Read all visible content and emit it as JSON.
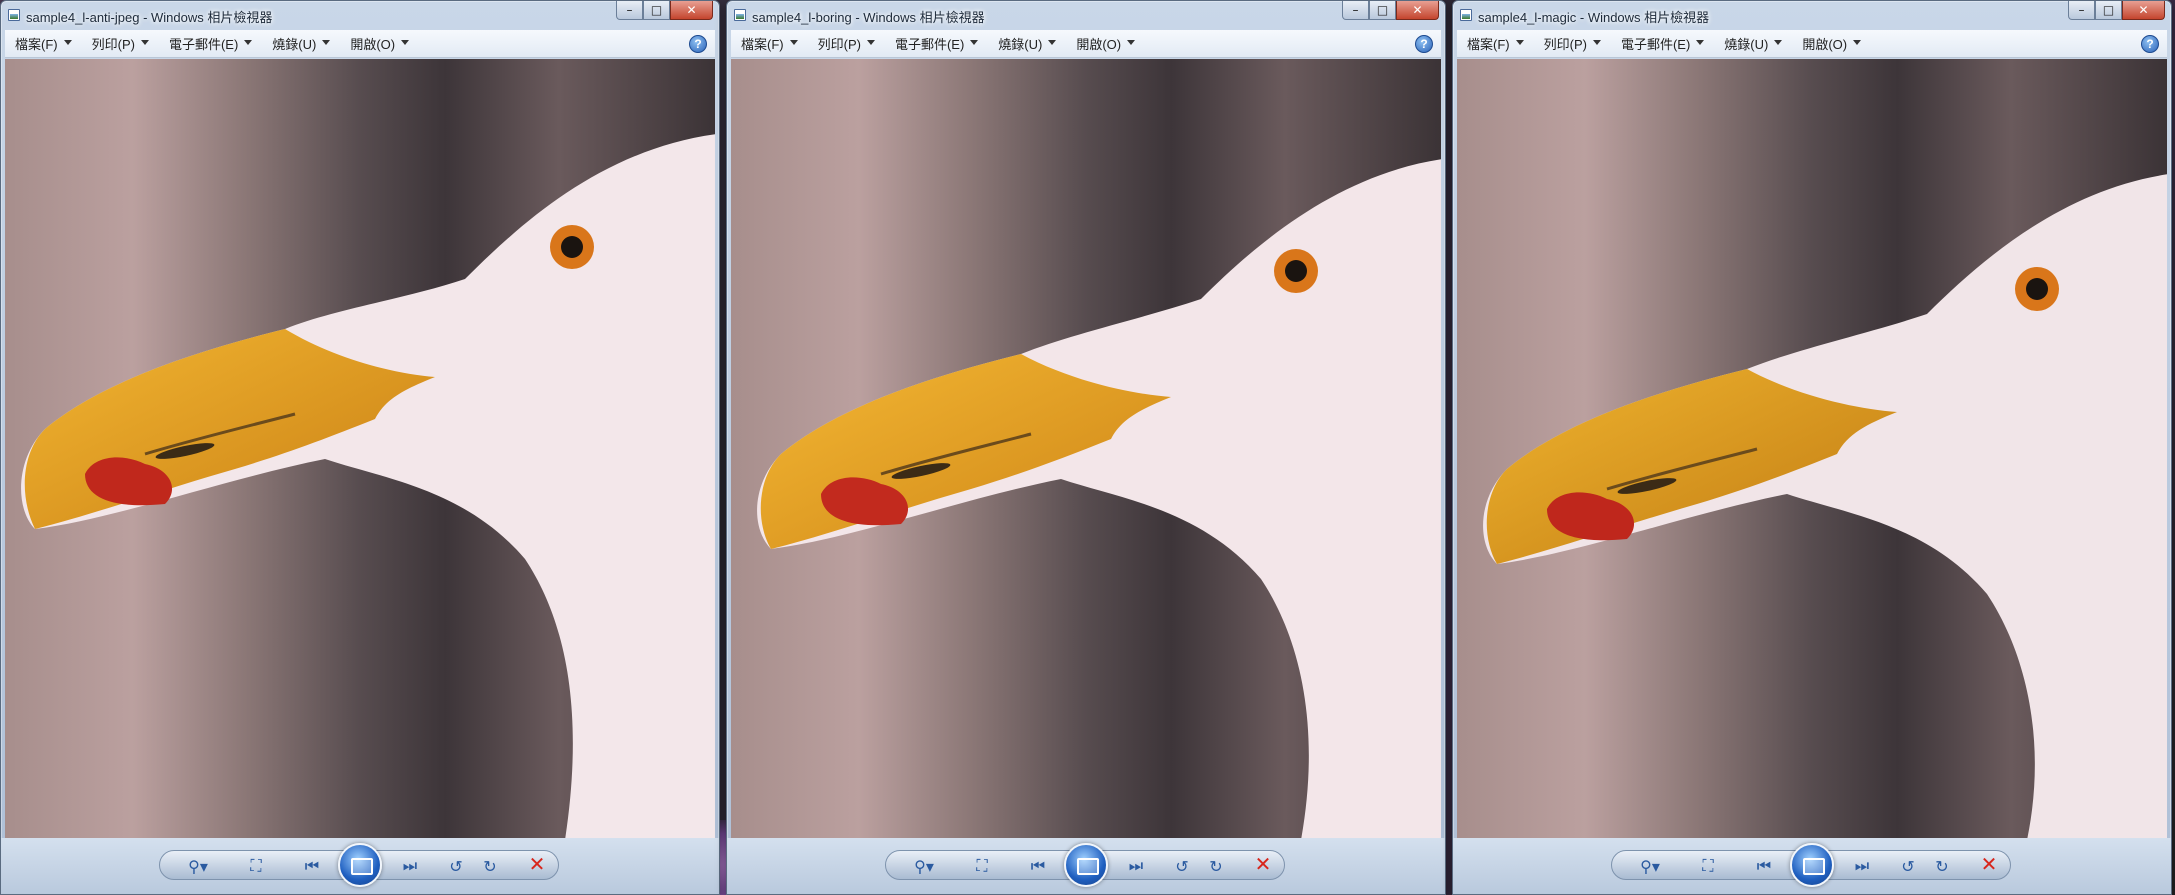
{
  "windows": [
    {
      "title": "sample4_l-anti-jpeg - Windows 相片檢視器",
      "menu": [
        "檔案(F)",
        "列印(P)",
        "電子郵件(E)",
        "燒錄(U)",
        "開啟(O)"
      ],
      "help": "?"
    },
    {
      "title": "sample4_l-boring - Windows 相片檢視器",
      "menu": [
        "檔案(F)",
        "列印(P)",
        "電子郵件(E)",
        "燒錄(U)",
        "開啟(O)"
      ],
      "help": "?"
    },
    {
      "title": "sample4_l-magic - Windows 相片檢視器",
      "menu": [
        "檔案(F)",
        "列印(P)",
        "電子郵件(E)",
        "燒錄(U)",
        "開啟(O)"
      ],
      "help": "?"
    }
  ],
  "caption_buttons": {
    "minimize": "–",
    "maximize": "□",
    "close": "✕"
  },
  "toolbar_icons": {
    "zoom": "⚲▾",
    "fit": "⛶",
    "previous": "⏮",
    "next": "⏭",
    "rotate_ccw": "↺",
    "rotate_cw": "↻",
    "delete": "✕"
  },
  "colors": {
    "beak": "#e8a21a",
    "beak_spot": "#c0281c",
    "head": "#f3e7ea",
    "eye_ring": "#d9761a"
  }
}
